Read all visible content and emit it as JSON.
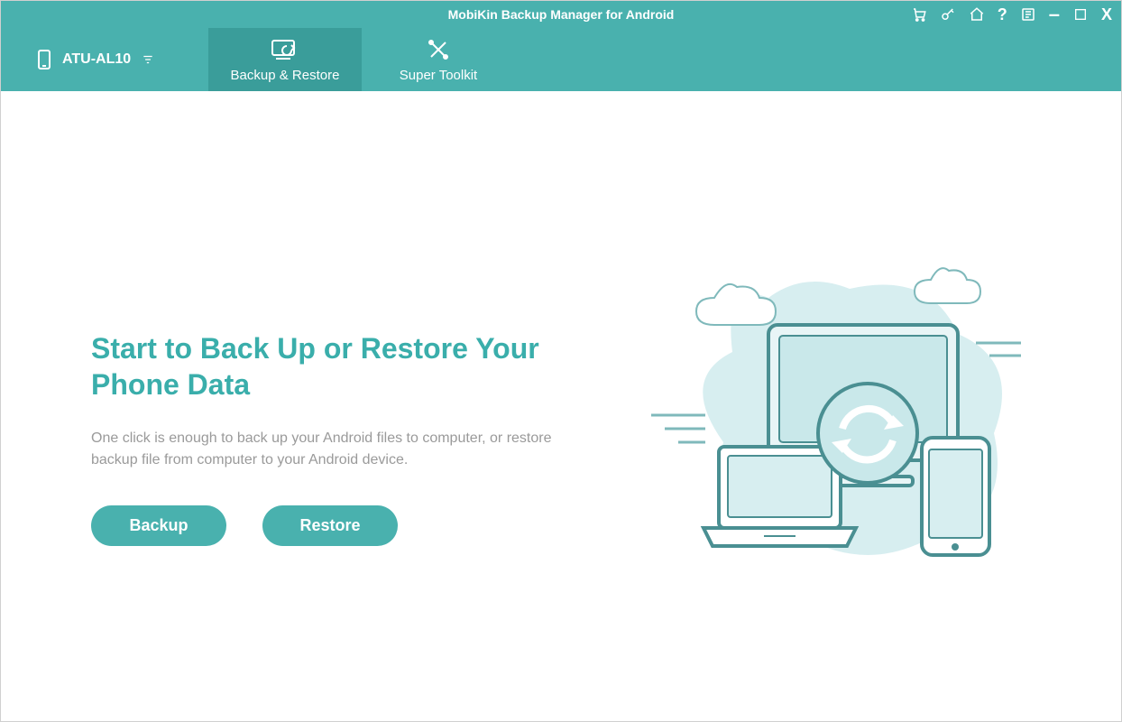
{
  "app": {
    "title": "MobiKin Backup Manager for Android"
  },
  "device": {
    "name": "ATU-AL10"
  },
  "tabs": {
    "backup_restore": "Backup & Restore",
    "super_toolkit": "Super Toolkit"
  },
  "main": {
    "heading": "Start to Back Up or Restore Your Phone Data",
    "description": "One click is enough to back up your Android files to computer, or restore backup file from computer to your Android device.",
    "backup_label": "Backup",
    "restore_label": "Restore"
  },
  "titlebar_icons": {
    "cart": "cart-icon",
    "key": "key-icon",
    "home": "home-icon",
    "help": "?",
    "feedback": "feedback-icon",
    "minimize": "–",
    "maximize": "maximize-icon",
    "close": "X"
  }
}
